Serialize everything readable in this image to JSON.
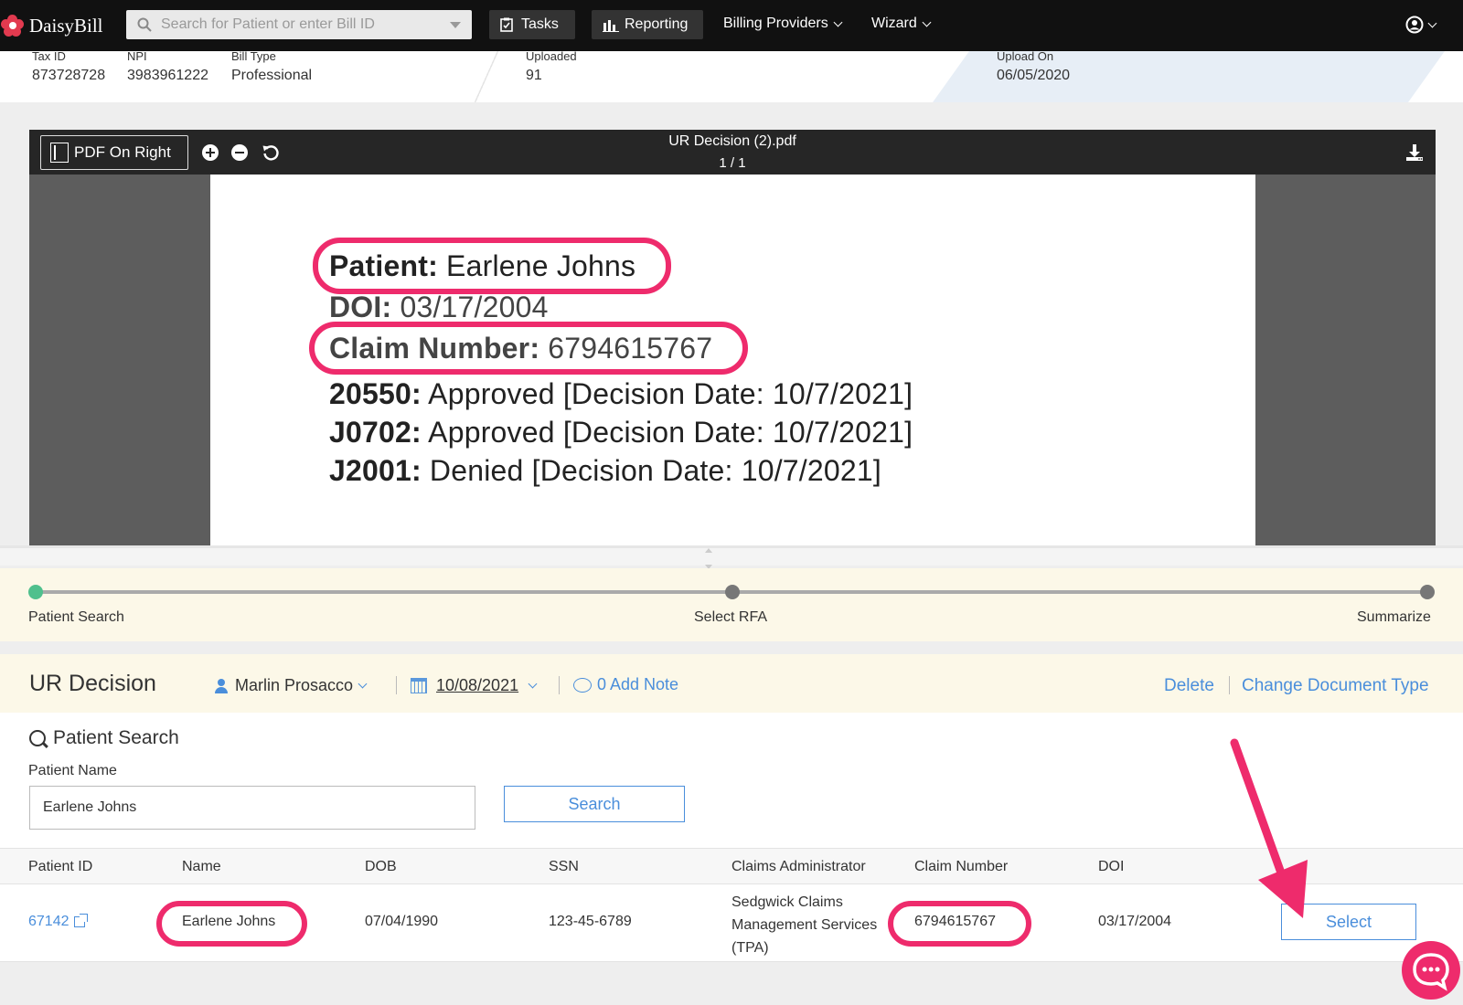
{
  "nav": {
    "brand": "DaisyBill",
    "search_placeholder": "Search for Patient or enter Bill ID",
    "tasks": "Tasks",
    "reporting": "Reporting",
    "billing_providers": "Billing Providers",
    "wizard": "Wizard"
  },
  "info": {
    "tax_id_label": "Tax ID",
    "tax_id": "873728728",
    "npi_label": "NPI",
    "npi": "3983961222",
    "bill_type_label": "Bill Type",
    "bill_type": "Professional",
    "uploaded_label": "Uploaded",
    "uploaded": "91",
    "upload_on_label": "Upload On",
    "upload_on": "06/05/2020"
  },
  "viewer": {
    "toggle_label": "PDF On Right",
    "file_name": "UR Decision (2).pdf",
    "page": "1 / 1",
    "lines": [
      {
        "key": "Patient:",
        "value": " Earlene Johns"
      },
      {
        "key": "DOI:",
        "value": " 03/17/2004"
      },
      {
        "key": "Claim Number:",
        "value": " 6794615767"
      },
      {
        "key": "20550:",
        "value": " Approved [Decision Date: 10/7/2021]"
      },
      {
        "key": "J0702:",
        "value": " Approved [Decision Date: 10/7/2021]"
      },
      {
        "key": "J2001:",
        "value": " Denied [Decision Date: 10/7/2021]"
      }
    ]
  },
  "steps": [
    {
      "label": "Patient Search",
      "active": true
    },
    {
      "label": "Select RFA",
      "active": false
    },
    {
      "label": "Summarize",
      "active": false
    }
  ],
  "ur": {
    "title": "UR Decision",
    "user": "Marlin Prosacco",
    "date": "10/08/2021",
    "note": "0 Add Note",
    "delete": "Delete",
    "change_type": "Change Document Type"
  },
  "patient_search": {
    "title": "Patient Search",
    "name_label": "Patient Name",
    "name_value": "Earlene Johns",
    "search_button": "Search"
  },
  "table": {
    "headers": [
      "Patient ID",
      "Name",
      "DOB",
      "SSN",
      "Claims Administrator",
      "Claim Number",
      "DOI"
    ],
    "row": {
      "patient_id": "67142",
      "name": "Earlene Johns",
      "dob": "07/04/1990",
      "ssn": "123-45-6789",
      "admin_line1": "Sedgwick Claims",
      "admin_line2": "Management Services",
      "admin_line3": "(TPA)",
      "claim_number": "6794615767",
      "doi": "03/17/2004",
      "select": "Select"
    }
  },
  "colors": {
    "accent": "#4a8edb",
    "highlight": "#ee2b6c",
    "nav_bg": "#111111",
    "step_active": "#4fc08d"
  }
}
